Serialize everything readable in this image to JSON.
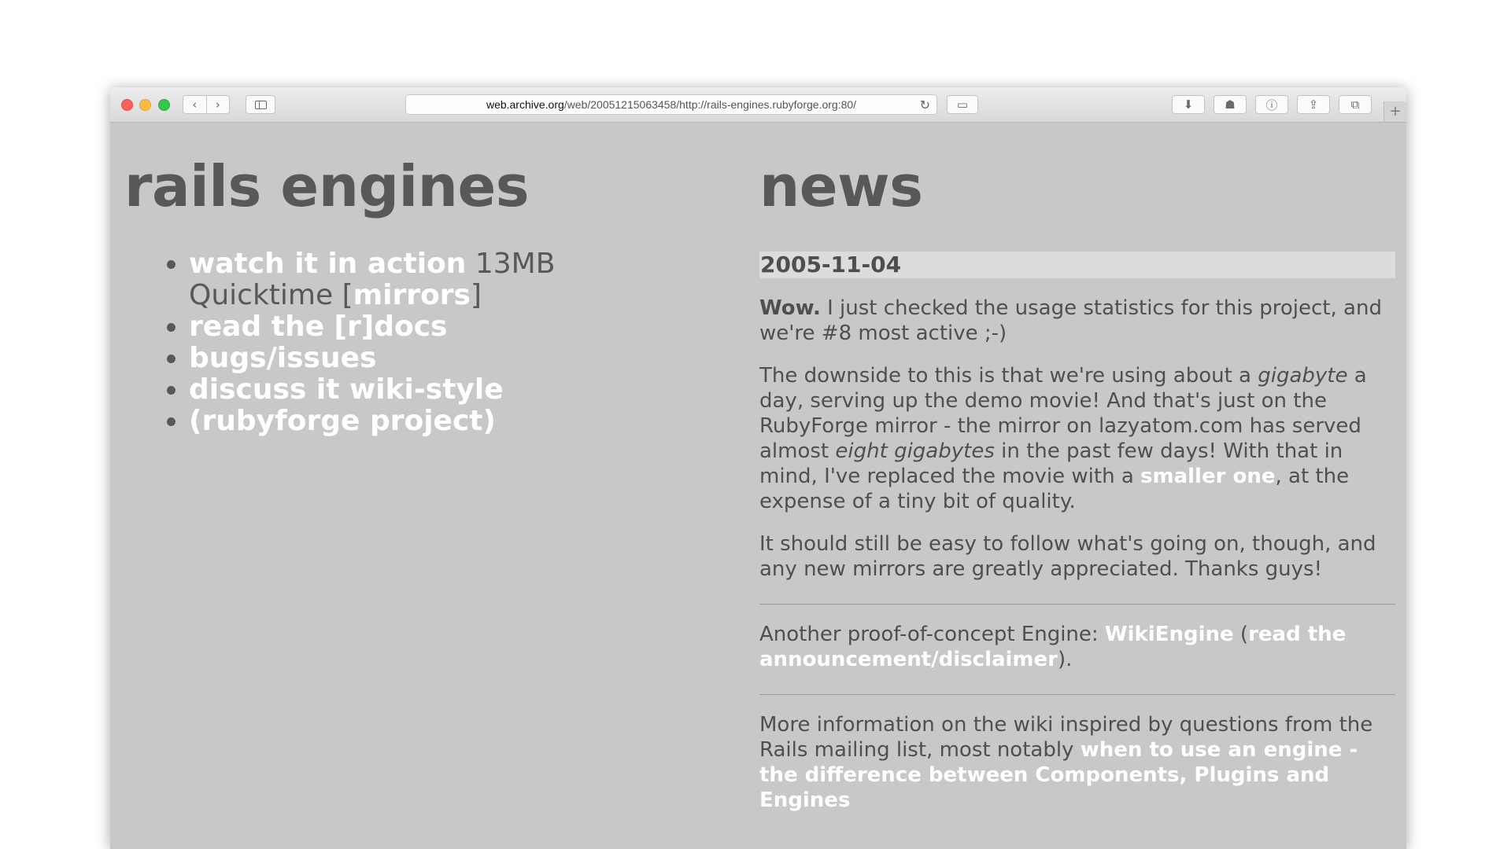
{
  "browser": {
    "url_host": "web.archive.org",
    "url_path": "/web/20051215063458/http://rails-engines.rubyforge.org:80/",
    "icons": [
      "back-icon",
      "forward-icon",
      "sidebar-icon",
      "reload-icon",
      "reader-icon",
      "download-icon",
      "ghostery-icon",
      "onepassword-icon",
      "share-icon",
      "tabs-icon",
      "new-tab-icon"
    ],
    "back_glyph": "‹",
    "forward_glyph": "›",
    "reload_glyph": "↻",
    "reader_glyph": "▭",
    "download_glyph": "⬇",
    "ghostery_glyph": "☗",
    "onepassword_glyph": "ⓘ",
    "share_glyph": "⇪",
    "tabs_glyph": "⧉",
    "plus_glyph": "+"
  },
  "left": {
    "title": "rails engines",
    "items": [
      {
        "link": "watch it in action",
        "text": " 13MB Quicktime ",
        "bracket_open": "[",
        "link2": "mirrors",
        "bracket_close": "]"
      },
      {
        "link": "read the [r]docs"
      },
      {
        "link": "bugs/issues"
      },
      {
        "link": "discuss it wiki-style"
      },
      {
        "link": "(rubyforge project)"
      }
    ]
  },
  "news": {
    "title": "news",
    "date": "2005-11-04",
    "p1_bold": "Wow.",
    "p1_text": " I just checked the usage statistics for this project, and we're #8 most active ;-)",
    "p2_a": "The downside to this is that we're using about a ",
    "p2_em1": "gigabyte",
    "p2_b": " a day, serving up the demo movie! And that's just on the RubyForge mirror - the mirror on lazyatom.com has served almost ",
    "p2_em2": "eight gigabytes",
    "p2_c": " in the past few days! With that in mind, I've replaced the movie with a ",
    "p2_link": "smaller one",
    "p2_d": ", at the expense of a tiny bit of quality.",
    "p3": "It should still be easy to follow what's going on, though, and any new mirrors are greatly appreciated. Thanks guys!",
    "p4_a": "Another proof-of-concept Engine: ",
    "p4_link1": "WikiEngine",
    "p4_b": " (",
    "p4_link2": "read the announcement/disclaimer",
    "p4_c": ").",
    "p5_a": "More information on the wiki inspired by questions from the Rails mailing list, most notably ",
    "p5_link": "when to use an engine - the difference between Components, Plugins and Engines"
  }
}
